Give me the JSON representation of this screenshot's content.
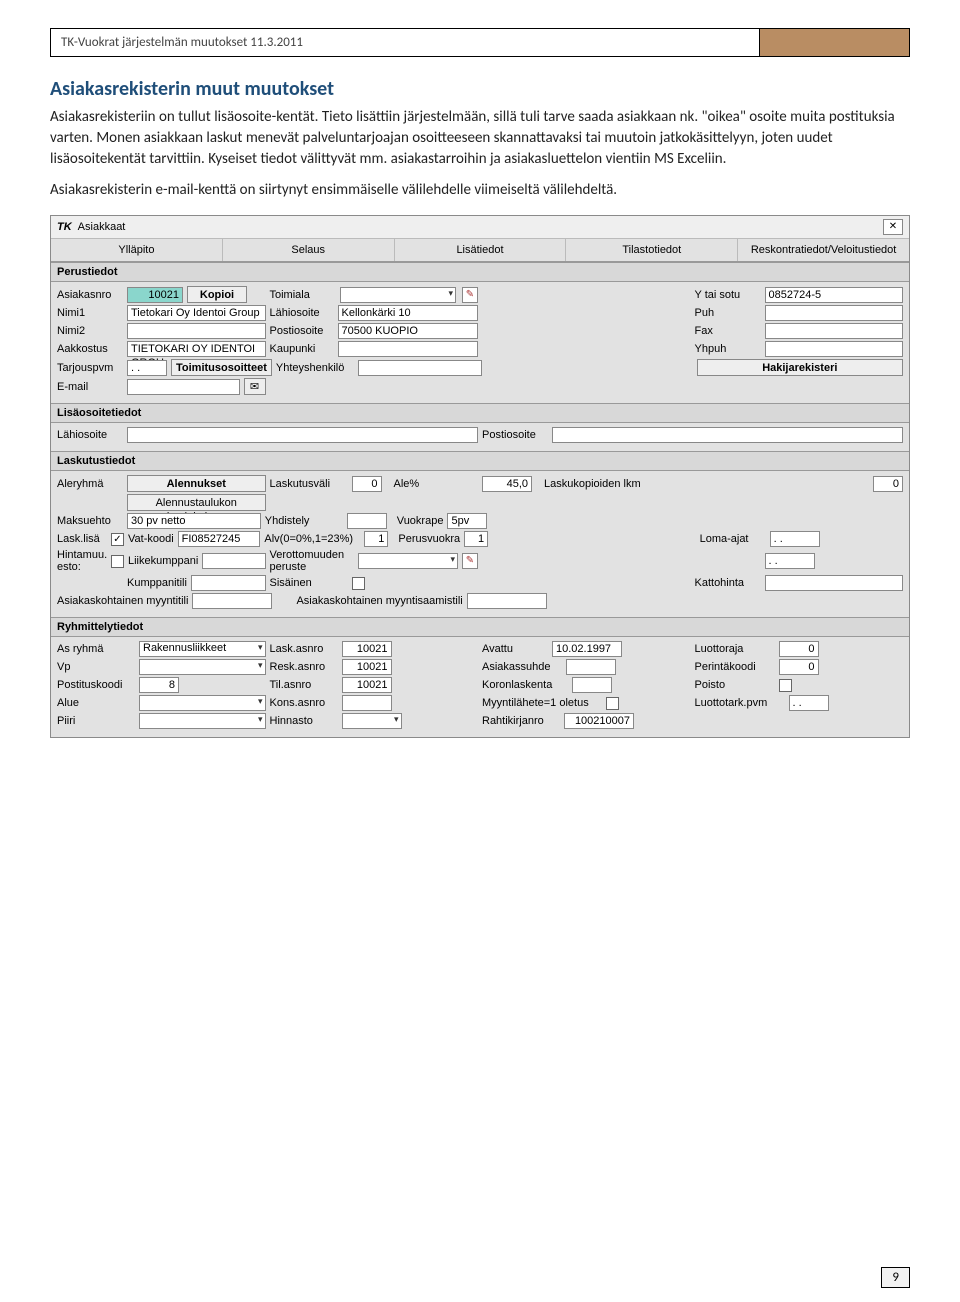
{
  "doc": {
    "header_text": "TK-Vuokrat järjestelmän muutokset 11.3.2011",
    "page_number": "9",
    "heading": "Asiakasrekisterin muut muutokset",
    "para1": "Asiakasrekisteriin on tullut lisäosoite-kentät. Tieto lisättiin järjestelmään, sillä tuli tarve saada asiakkaan nk. \"oikea\" osoite muita postituksia varten. Monen asiakkaan laskut menevät palveluntarjoajan osoitteeseen skannattavaksi tai muutoin jatkokäsittelyyn, joten uudet lisäosoitekentät tarvittiin. Kyseiset tiedot välittyvät mm. asiakastarroihin ja asiakasluettelon vientiin MS Exceliin.",
    "para2": "Asiakasrekisterin e-mail-kenttä on siirtynyt ensimmäiselle välilehdelle viimeiseltä välilehdeltä."
  },
  "win": {
    "logo": "TK",
    "title": "Asiakkaat",
    "close": "✕"
  },
  "tabs": {
    "t1": "Ylläpito",
    "t2": "Selaus",
    "t3": "Lisätiedot",
    "t4": "Tilastotiedot",
    "t5": "Reskontratiedot/Veloitustiedot"
  },
  "groups": {
    "g1": "Perustiedot",
    "g2": "Lisäosoitetiedot",
    "g3": "Laskutustiedot",
    "g4": "Ryhmittelytiedot"
  },
  "perus": {
    "asiakasnro_lbl": "Asiakasnro",
    "asiakasnro_val": "10021",
    "kopioi_btn": "Kopioi",
    "toimiala_lbl": "Toimiala",
    "ysotu_lbl": "Y tai sotu",
    "ysotu_val": "0852724-5",
    "nimi1_lbl": "Nimi1",
    "nimi1_val": "Tietokari Oy Identoi Group",
    "lahiosoite_lbl": "Lähiosoite",
    "lahiosoite_val": "Kellonkärki 10",
    "puh_lbl": "Puh",
    "nimi2_lbl": "Nimi2",
    "postiosoite_lbl": "Postiosoite",
    "postiosoite_val": "70500 KUOPIO",
    "fax_lbl": "Fax",
    "aakkostus_lbl": "Aakkostus",
    "aakkostus_val": "TIETOKARI OY IDENTOI GROU",
    "kaupunki_lbl": "Kaupunki",
    "yhpuh_lbl": "Yhpuh",
    "tarjouspvm_lbl": "Tarjouspvm",
    "tarjouspvm_val": ". .",
    "toimitusosoitteet_btn": "Toimitusosoitteet",
    "yhteyshenkilo_lbl": "Yhteyshenkilö",
    "hakijarekisteri_btn": "Hakijarekisteri",
    "email_lbl": "E-mail"
  },
  "lisa": {
    "lahiosoite_lbl": "Lähiosoite",
    "postiosoite_lbl": "Postiosoite"
  },
  "lasku": {
    "aleryhma_lbl": "Aleryhmä",
    "alennukset_btn": "Alennukset",
    "laskutusvali_lbl": "Laskutusväli",
    "laskutusvali_val": "0",
    "alepct_lbl": "Ale%",
    "alepct_val": "45,0",
    "laskukopiot_lbl": "Laskukopioiden lkm",
    "laskukopiot_val": "0",
    "alennustaulu_btn": "Alennustaulukon kopioiminen",
    "maksuehto_lbl": "Maksuehto",
    "maksuehto_val": "30 pv netto",
    "yhdistely_lbl": "Yhdistely",
    "vuokrape_lbl": "Vuokrape",
    "vuokrape_val": "5pv",
    "lasklisa_lbl": "Lask.lisä",
    "lasklisa_chk": "✓",
    "vatkoodi_lbl": "Vat-koodi",
    "vatkoodi_val": "FI08527245",
    "alv_lbl": "Alv(0=0%,1=23%)",
    "alv_val": "1",
    "perusvuokra_lbl": "Perusvuokra",
    "perusvuokra_val": "1",
    "lomaajat_lbl": "Loma-ajat",
    "lomaajat_val": ". .",
    "hintamuu_lbl": "Hintamuu. esto:",
    "liikekumppani_lbl": "Liikekumppani",
    "verottomuuden_lbl": "Verottomuuden peruste",
    "empty_dots": ". .",
    "kumppanitili_lbl": "Kumppanitili",
    "sisainen_lbl": "Sisäinen",
    "kattohinta_lbl": "Kattohinta",
    "asiakaskoht_myyntitili_lbl": "Asiakaskohtainen myyntitili",
    "asiakaskoht_myyntisaamis_lbl": "Asiakaskohtainen myyntisaamistili"
  },
  "ryhma": {
    "asryhma_lbl": "As ryhmä",
    "asryhma_val": "Rakennusliikkeet",
    "laskasnro_lbl": "Lask.asnro",
    "laskasnro_val": "10021",
    "avattu_lbl": "Avattu",
    "avattu_val": "10.02.1997",
    "luottoraja_lbl": "Luottoraja",
    "luottoraja_val": "0",
    "vp_lbl": "Vp",
    "reskasnro_lbl": "Resk.asnro",
    "reskasnro_val": "10021",
    "asiakassuhde_lbl": "Asiakassuhde",
    "perintakoodi_lbl": "Perintäkoodi",
    "perintakoodi_val": "0",
    "postituskoodi_lbl": "Postituskoodi",
    "postituskoodi_val": "8",
    "tilasnro_lbl": "Til.asnro",
    "tilasnro_val": "10021",
    "koronlaskenta_lbl": "Koronlaskenta",
    "poisto_lbl": "Poisto",
    "alue_lbl": "Alue",
    "konsasnro_lbl": "Kons.asnro",
    "myyntilahete_lbl": "Myyntilähete=1 oletus",
    "luottotark_lbl": "Luottotark.pvm",
    "luottotark_val": ". .",
    "piiri_lbl": "Piiri",
    "hinnasto_lbl": "Hinnasto",
    "rahtikirjanro_lbl": "Rahtikirjanro",
    "rahtikirjanro_val": "100210007"
  }
}
